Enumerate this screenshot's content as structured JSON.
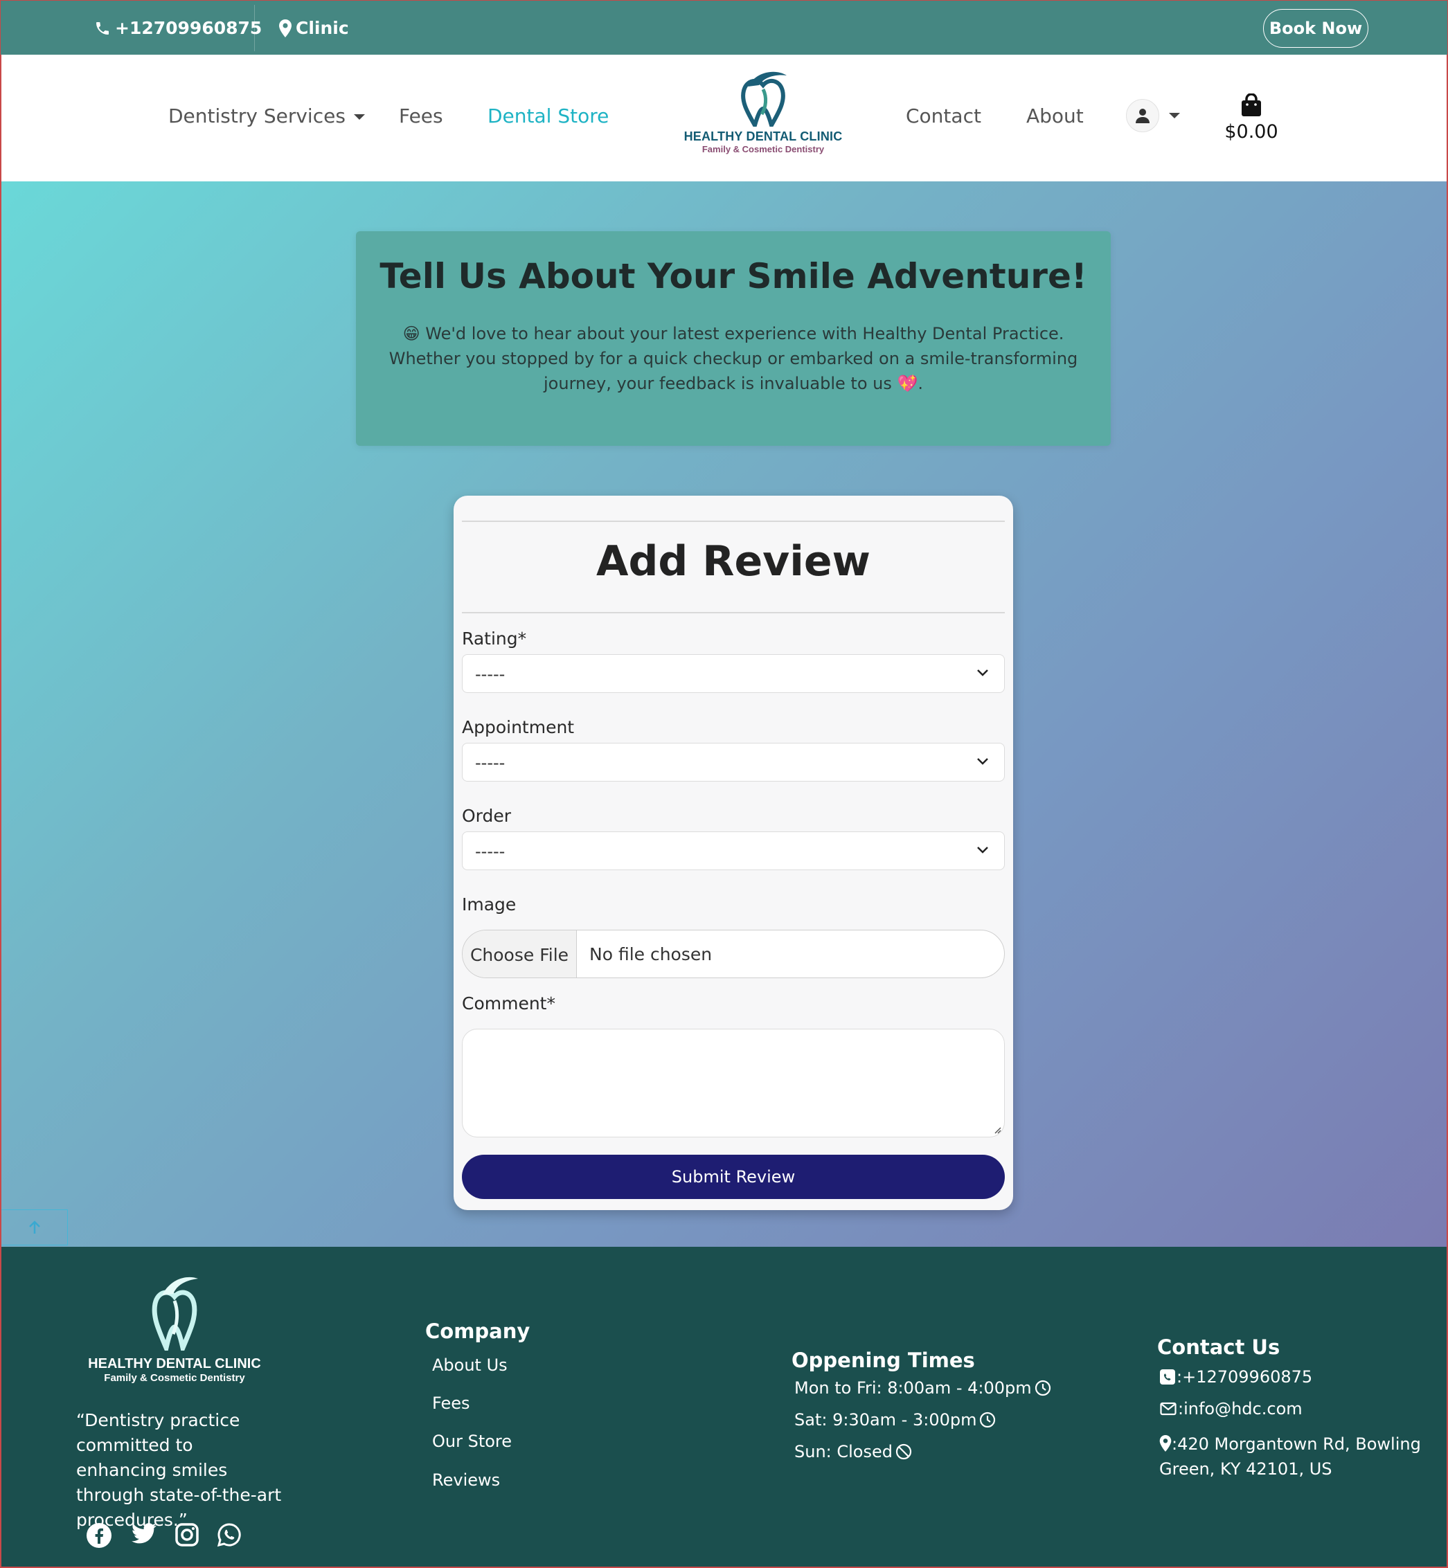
{
  "topbar": {
    "phone": "+12709960875",
    "location": "Clinic",
    "book_now": "Book Now"
  },
  "nav": {
    "services": "Dentistry Services",
    "fees": "Fees",
    "store": "Dental Store",
    "contact": "Contact",
    "about": "About",
    "cart_total": "$0.00",
    "logo_name": "HEALTHY DENTAL CLINIC",
    "logo_sub": "Family & Cosmetic Dentistry"
  },
  "intro": {
    "title": "Tell Us About Your Smile Adventure!",
    "text": "😁 We'd love to hear about your latest experience with Healthy Dental Practice. Whether you stopped by for a quick checkup or embarked on a smile-transforming journey, your feedback is invaluable to us 💖."
  },
  "form": {
    "title": "Add Review",
    "rating_label": "Rating*",
    "rating_value": "-----",
    "appointment_label": "Appointment",
    "appointment_value": "-----",
    "order_label": "Order",
    "order_value": "-----",
    "image_label": "Image",
    "choose_file": "Choose File",
    "no_file": "No file chosen",
    "comment_label": "Comment*",
    "submit": "Submit Review"
  },
  "footer": {
    "logo_name": "HEALTHY DENTAL CLINIC",
    "logo_sub": "Family & Cosmetic Dentistry",
    "quote": "“Dentistry practice committed to enhancing smiles through state-of-the-art procedures.”",
    "company_heading": "Company",
    "company_links": [
      "About Us",
      "Fees",
      "Our Store",
      "Reviews"
    ],
    "hours_heading": "Oppening Times",
    "hours": [
      "Mon to Fri: 8:00am - 4:00pm",
      "Sat: 9:30am - 3:00pm",
      "Sun: Closed"
    ],
    "contact_heading": "Contact Us",
    "phone": ":+12709960875",
    "email": ":info@hdc.com",
    "address": ":420 Morgantown Rd, Bowling Green, KY 42101, US"
  },
  "colors": {
    "topbar": "#458782",
    "accent": "#1eb3c4",
    "submit": "#1e1d72",
    "footer": "#1b4f4e",
    "intro_box": "#5aaba4"
  },
  "icons": [
    "phone-icon",
    "map-marker-icon",
    "user-icon",
    "shopping-bag-icon",
    "chevron-down-icon",
    "arrow-up-icon",
    "facebook-icon",
    "twitter-icon",
    "instagram-icon",
    "whatsapp-icon",
    "clock-icon",
    "ban-icon",
    "phone-square-icon",
    "envelope-icon"
  ]
}
